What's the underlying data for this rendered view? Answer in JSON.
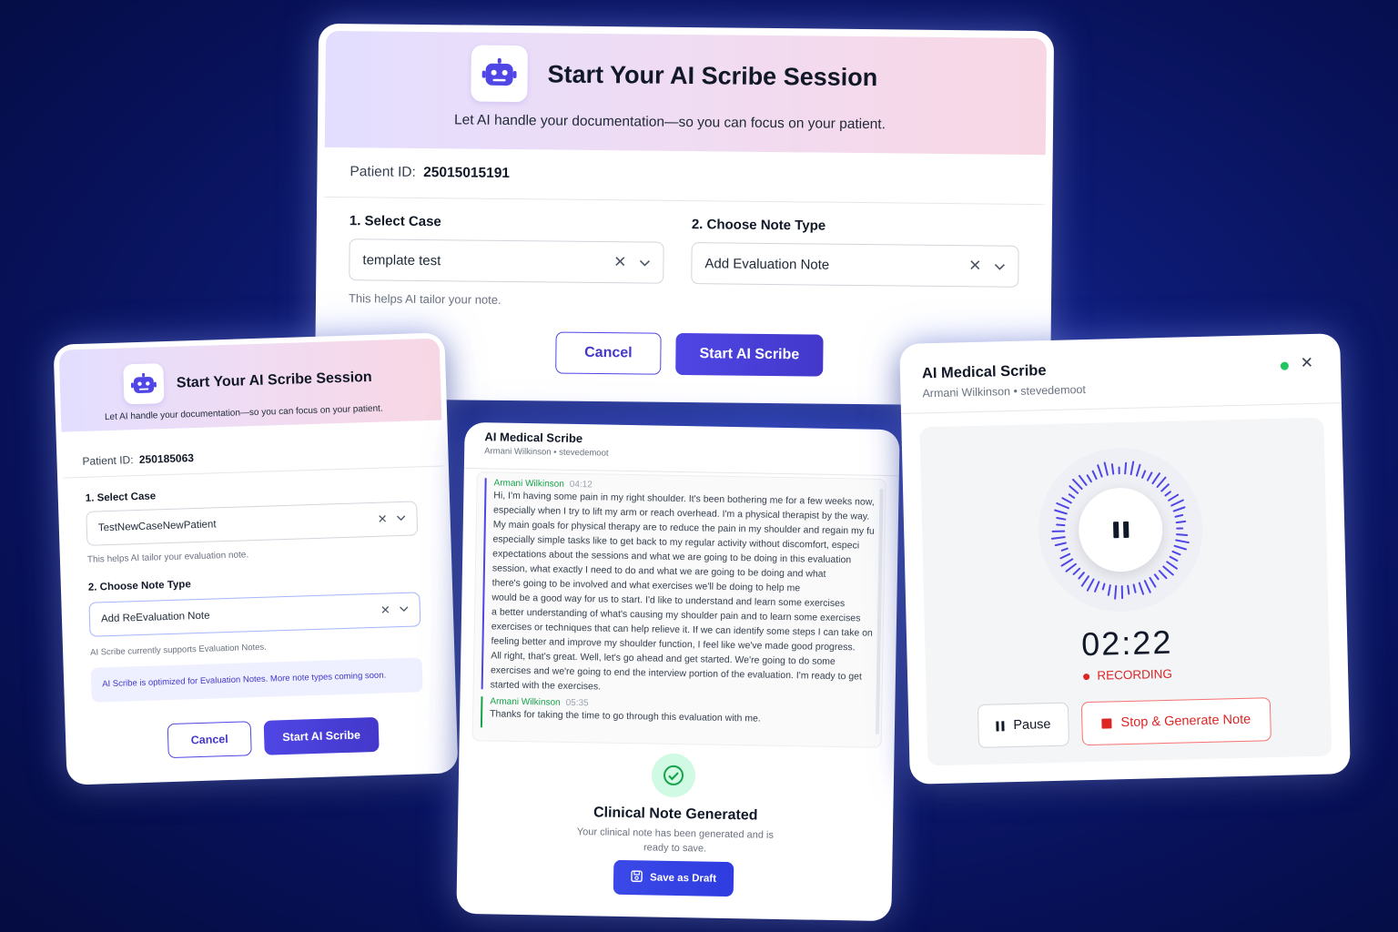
{
  "main_card": {
    "title": "Start Your AI Scribe Session",
    "subtitle": "Let AI handle your documentation—so you can focus on your patient.",
    "patient_label": "Patient ID:",
    "patient_id": "25015015191",
    "case_label": "1. Select Case",
    "case_value": "template test",
    "case_hint": "This helps AI tailor your note.",
    "note_label": "2. Choose Note Type",
    "note_value": "Add Evaluation Note",
    "cancel_label": "Cancel",
    "start_label": "Start AI Scribe"
  },
  "left_card": {
    "title": "Start Your AI Scribe Session",
    "subtitle": "Let AI handle your documentation—so you can focus on your patient.",
    "patient_label": "Patient ID:",
    "patient_id": "250185063",
    "case_label": "1. Select Case",
    "case_value": "TestNewCaseNewPatient",
    "case_hint": "This helps AI tailor your evaluation note.",
    "note_label": "2. Choose Note Type",
    "note_value": "Add ReEvaluation Note",
    "note_hint": "AI Scribe currently supports Evaluation Notes.",
    "info_banner": "AI Scribe is optimized for Evaluation Notes. More note types coming soon.",
    "cancel_label": "Cancel",
    "start_label": "Start AI Scribe"
  },
  "mid_card": {
    "title": "AI Medical Scribe",
    "subtitle": "Armani Wilkinson • stevedemoot",
    "entries": [
      {
        "speaker": "Armani Wilkinson",
        "time": "04:12",
        "lines": [
          "Hi, I'm having some pain in my right shoulder. It's been bothering me for a few weeks now,",
          "especially when I try to lift my arm or reach overhead. I'm a physical therapist by the way.",
          "My main goals for physical therapy are to reduce the pain in my shoulder and regain my fu",
          "especially simple tasks like to get back to my regular activity without discomfort, especi",
          "expectations about the sessions and what we are going to be doing in this evaluation",
          "session, what exactly I need to do and what we are going to be doing and what",
          "there's going to be involved and what exercises we'll be doing to help me",
          "would be a good way for us to start. I'd like to understand and learn some exercises",
          "a better understanding of what's causing my shoulder pain and to learn some exercises",
          "exercises or techniques that can help relieve it. If we can identify some steps I can take on",
          "feeling better and improve my shoulder function, I feel like we've made good progress.",
          "All right, that's great. Well, let's go ahead and get started. We're going to do some",
          "exercises and we're going to end the interview portion of the evaluation. I'm ready to get",
          "started with the exercises."
        ]
      },
      {
        "speaker": "Armani Wilkinson",
        "time": "05:35",
        "lines": [
          "Thanks for taking the time to go through this evaluation with me."
        ]
      }
    ],
    "status_title": "Clinical Note Generated",
    "status_text_1": "Your clinical note has been generated and is",
    "status_text_2": "ready to save.",
    "save_label": "Save as Draft"
  },
  "right_card": {
    "title": "AI Medical Scribe",
    "subtitle": "Armani Wilkinson • stevedemoot",
    "timer": "02:22",
    "status": "RECORDING",
    "pause_label": "Pause",
    "stop_label": "Stop & Generate Note"
  },
  "colors": {
    "accent": "#4f46e5",
    "recording": "#dc2626",
    "live_dot": "#22c55e",
    "success": "#16a34a"
  }
}
